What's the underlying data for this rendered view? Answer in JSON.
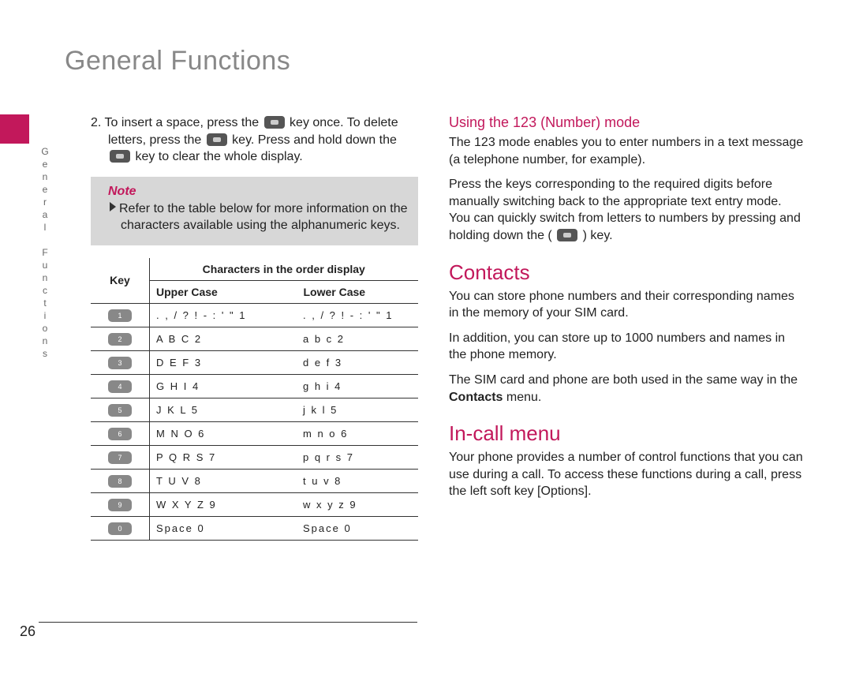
{
  "page_number": "26",
  "side_label": "General Functions",
  "title": "General Functions",
  "left": {
    "para1_a": "2. To insert a space, press the ",
    "para1_b": " key once. To delete letters, press the ",
    "para1_c": " key. Press and hold down the ",
    "para1_d": " key to clear the whole display.",
    "note_title": "Note",
    "note_body": "Refer to the table below for more information on the characters available using the alphanumeric keys.",
    "table": {
      "hdr_key": "Key",
      "hdr_chars": "Characters in the order display",
      "hdr_upper": "Upper Case",
      "hdr_lower": "Lower Case",
      "rows": [
        {
          "k": "1",
          "u": ". , / ? ! - : ' \" 1",
          "l": ". , / ? ! - : ' \" 1"
        },
        {
          "k": "2",
          "u": "A B C 2",
          "l": "a b c 2"
        },
        {
          "k": "3",
          "u": "D E F 3",
          "l": "d e f 3"
        },
        {
          "k": "4",
          "u": "G H I 4",
          "l": "g h i 4"
        },
        {
          "k": "5",
          "u": "J K L 5",
          "l": "j k l 5"
        },
        {
          "k": "6",
          "u": "M N O 6",
          "l": "m n o 6"
        },
        {
          "k": "7",
          "u": "P Q R S 7",
          "l": "p q r s 7"
        },
        {
          "k": "8",
          "u": "T U V 8",
          "l": "t u v 8"
        },
        {
          "k": "9",
          "u": "W X Y Z 9",
          "l": "w x y z 9"
        },
        {
          "k": "0",
          "u": "Space 0",
          "l": "Space 0"
        }
      ]
    }
  },
  "right": {
    "h_123": "Using the 123 (Number) mode",
    "p_123a": "The 123 mode enables you to enter numbers in a text message (a telephone number, for example).",
    "p_123b_a": "Press the keys corresponding to the required digits before manually switching back to the appropriate text entry mode. You can quickly switch from letters to numbers by pressing and holding down the ( ",
    "p_123b_b": " ) key.",
    "h_contacts": "Contacts",
    "p_c1": "You can store phone numbers and their corresponding names in the memory of your SIM card.",
    "p_c2": "In addition, you can store up to 1000 numbers and names in the phone memory.",
    "p_c3_a": "The SIM card and phone are both used in the same way in the ",
    "p_c3_bold": "Contacts",
    "p_c3_b": " menu.",
    "h_incall": "In-call menu",
    "p_i1": "Your phone provides a number of control functions that you can use during a call. To access these functions during a call, press the left soft key [Options]."
  }
}
